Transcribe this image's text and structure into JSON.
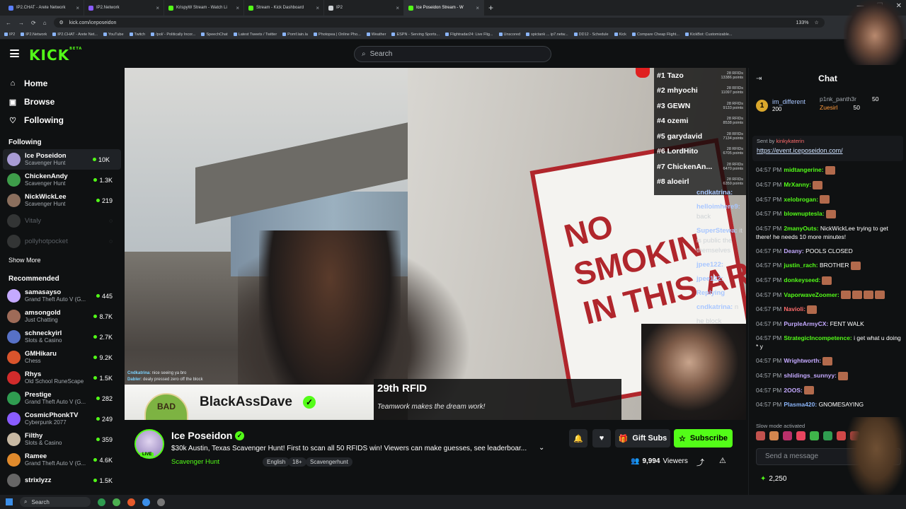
{
  "browser": {
    "tabs": [
      {
        "label": "IP2.CHAT - Arete Network",
        "color": "#5b7fff"
      },
      {
        "label": "IP2.Network",
        "color": "#8a5cff"
      },
      {
        "label": "KrispyW Stream - Watch Li",
        "color": "#53fc18"
      },
      {
        "label": "Stream - Kick Dashboard",
        "color": "#53fc18"
      },
      {
        "label": "IP2",
        "color": "#cfd3d6"
      },
      {
        "label": "Ice Poseidon Stream - W",
        "color": "#53fc18"
      }
    ],
    "url": "kick.com/iceposeidon",
    "zoom": "133%",
    "bookmarks": [
      "IP2",
      "IP2.Network",
      "IP2.CHAT - Arete Net...",
      "YouTube",
      "Twitch",
      "/pol/ - Politically Incor...",
      "SpeechChat",
      "Latest Tweets / Twitter",
      "Pomf.lain.la",
      "Photopea | Online Pho...",
      "Weather",
      "ESPN - Serving Sports...",
      "Flightradar24: Live Flig...",
      "Unscored",
      "spictank ... ip7.netw...",
      "DD12 - Schedule",
      "Kick",
      "Compare Cheap Flight...",
      "KickBot: Customizable..."
    ]
  },
  "kick": {
    "logo": "KICK",
    "logo_sup": "BETA",
    "search_placeholder": "Search"
  },
  "sidebar": {
    "nav": [
      {
        "label": "Home",
        "icon": "home-icon",
        "glyph": "⌂"
      },
      {
        "label": "Browse",
        "icon": "browse-icon",
        "glyph": "▣"
      },
      {
        "label": "Following",
        "icon": "heart-icon",
        "glyph": "♡"
      }
    ],
    "following_title": "Following",
    "following": [
      {
        "name": "Ice Poseidon",
        "category": "Scavenger Hunt",
        "viewers": "10K",
        "color": "#a99cd6",
        "selected": true
      },
      {
        "name": "ChickenAndy",
        "category": "Scavenger Hunt",
        "viewers": "1.3K",
        "color": "#3e9d4a"
      },
      {
        "name": "NickWickLee",
        "category": "Scavenger Hunt",
        "viewers": "219",
        "color": "#8b6f5d"
      },
      {
        "name": "Vitaly",
        "category": "",
        "viewers": "",
        "color": "#777777",
        "offline": true
      },
      {
        "name": "pollyhotpocket",
        "category": "",
        "viewers": "",
        "color": "#777777",
        "offline": true
      }
    ],
    "show_more": "Show More",
    "recommended_title": "Recommended",
    "recommended": [
      {
        "name": "samasayso",
        "category": "Grand Theft Auto V (G...",
        "viewers": "445",
        "color": "#c4a9ff"
      },
      {
        "name": "amsongold",
        "category": "Just Chatting",
        "viewers": "8.7K",
        "color": "#9e6b58"
      },
      {
        "name": "schneckyirl",
        "category": "Slots & Casino",
        "viewers": "2.7K",
        "color": "#5771c7"
      },
      {
        "name": "GMHikaru",
        "category": "Chess",
        "viewers": "9.2K",
        "color": "#d9542c"
      },
      {
        "name": "Rhys",
        "category": "Old School RuneScape",
        "viewers": "1.5K",
        "color": "#d12b2b"
      },
      {
        "name": "Prestige",
        "category": "Grand Theft Auto V (G...",
        "viewers": "282",
        "color": "#2f9c50"
      },
      {
        "name": "CosmicPhonkTV",
        "category": "Cyberpunk 2077",
        "viewers": "249",
        "color": "#8a5cff"
      },
      {
        "name": "Filthy",
        "category": "Slots & Casino",
        "viewers": "359",
        "color": "#c8b9a3"
      },
      {
        "name": "Ramee",
        "category": "Grand Theft Auto V (G...",
        "viewers": "4.6K",
        "color": "#e08a2c"
      },
      {
        "name": "strixlyzz",
        "category": "",
        "viewers": "1.5K",
        "color": "#666666"
      }
    ]
  },
  "video": {
    "leaderboard": [
      {
        "rank": "#1",
        "name": "Tazo",
        "rfids": "28 RFIDs",
        "points": "13386 points"
      },
      {
        "rank": "#2",
        "name": "mhyochi",
        "rfids": "28 RFIDs",
        "points": "11097 points"
      },
      {
        "rank": "#3",
        "name": "GEWN",
        "rfids": "28 RFIDs",
        "points": "9133 points"
      },
      {
        "rank": "#4",
        "name": "ozemi",
        "rfids": "28 RFIDs",
        "points": "8538 points"
      },
      {
        "rank": "#5",
        "name": "garydavid",
        "rfids": "28 RFIDs",
        "points": "7134 points"
      },
      {
        "rank": "#6",
        "name": "LordHito",
        "rfids": "28 RFIDs",
        "points": "6705 points"
      },
      {
        "rank": "#7",
        "name": "ChickenAn...",
        "rfids": "28 RFIDs",
        "points": "6470 points"
      },
      {
        "rank": "#8",
        "name": "aloeirl",
        "rfids": "28 RFIDs",
        "points": "6359 points"
      }
    ],
    "sign_text": "NO SMOKIN IN THIS AR",
    "overlay_chat": [
      {
        "user": "cndkatrina:",
        "text": ""
      },
      {
        "user": "helloimhere9:",
        "text": "back"
      },
      {
        "user": "SuperStewa:",
        "text": "it is public the themselves"
      },
      {
        "user": "jpee122:",
        "text": ""
      },
      {
        "user": "jpee122:",
        "text": ""
      },
      {
        "user": "Replying",
        "text": ""
      },
      {
        "user": "cndkatrina:",
        "text": "n"
      },
      {
        "user": "",
        "text": "he block"
      }
    ],
    "small_chat": [
      {
        "user": "Cndkatrina",
        "text": ": nice seeing ya bro"
      },
      {
        "user": "Dabler",
        "text": ": dealy pressed zero off the block"
      }
    ],
    "rfid_title": "29th RFID",
    "rfid_sub": "Teamwork makes the dream work!",
    "dave_name": "BlackAssDave",
    "dave_badge": "BAD"
  },
  "stream": {
    "name": "Ice Poseidon",
    "live": "LIVE",
    "title": "$30k Austin, Texas Scavenger Hunt! First to scan all 50 RFIDS win! Viewers can make guesses, see leaderboar...",
    "category": "Scavenger Hunt",
    "tags": [
      "English",
      "18+",
      "Scavengerhunt"
    ],
    "gift_subs": "Gift Subs",
    "subscribe": "Subscribe",
    "viewers": "9,994",
    "viewers_label": "Viewers"
  },
  "chat": {
    "title": "Chat",
    "top_gifter": {
      "name": "im_different",
      "count": "200"
    },
    "gifters": [
      {
        "name": "p1nk_panth3r",
        "count": "50"
      },
      {
        "name": "Zuesirl",
        "count": "50"
      }
    ],
    "pinned_by": "Sent by",
    "pinned_user": "kinkykaterin",
    "pinned_link": "https://event.iceposeidon.com/",
    "messages": [
      {
        "time": "04:57 PM",
        "user": "midtangerine:",
        "text": "",
        "color": "#53fc18",
        "emotes": 1
      },
      {
        "time": "04:57 PM",
        "user": "MrXanny:",
        "text": "",
        "color": "#53fc18",
        "emotes": 1
      },
      {
        "time": "04:57 PM",
        "user": "xelobrogan:",
        "text": "",
        "color": "#53fc18",
        "emotes": 1
      },
      {
        "time": "04:57 PM",
        "user": "blownuptesla:",
        "text": "",
        "color": "#53fc18",
        "emotes": 1
      },
      {
        "time": "04:57 PM",
        "user": "2manyOuts:",
        "text": "NickWickLee trying to get there! he needs 10 more minutes!",
        "color": "#53fc18",
        "emotes": 0
      },
      {
        "time": "04:57 PM",
        "user": "Deany:",
        "text": "POOLS CLOSED",
        "color": "#c4a9ff",
        "emotes": 0
      },
      {
        "time": "04:57 PM",
        "user": "justin_rach:",
        "text": "BROTHER",
        "color": "#53fc18",
        "emotes": 1
      },
      {
        "time": "04:57 PM",
        "user": "donkeyseed:",
        "text": "",
        "color": "#53fc18",
        "emotes": 1
      },
      {
        "time": "04:57 PM",
        "user": "VaporwaveZoomer:",
        "text": "",
        "color": "#53fc18",
        "emotes": 4
      },
      {
        "time": "04:57 PM",
        "user": "Navioli:",
        "text": "",
        "color": "#ff6b6b",
        "emotes": 1
      },
      {
        "time": "04:57 PM",
        "user": "PurpleArmyCX:",
        "text": "FENT WALK",
        "color": "#c4a9ff",
        "emotes": 0
      },
      {
        "time": "04:57 PM",
        "user": "StrategicIncompetence:",
        "text": "i get what u doing * y",
        "color": "#53fc18",
        "emotes": 0
      },
      {
        "time": "04:57 PM",
        "user": "Wrightworth:",
        "text": "",
        "color": "#c4a9ff",
        "emotes": 1
      },
      {
        "time": "04:57 PM",
        "user": "shlidings_sunnyy:",
        "text": "",
        "color": "#c4a9ff",
        "emotes": 1
      },
      {
        "time": "04:57 PM",
        "user": "2OOS:",
        "text": "",
        "color": "#c4a9ff",
        "emotes": 1
      },
      {
        "time": "04:57 PM",
        "user": "Plasma420:",
        "text": "GNOMESAYING",
        "color": "#8ab4f8",
        "emotes": 0
      }
    ],
    "slow_mode": "Slow mode activated",
    "send_placeholder": "Send a message",
    "points": "2,250"
  },
  "taskbar": {
    "search": "Search"
  }
}
